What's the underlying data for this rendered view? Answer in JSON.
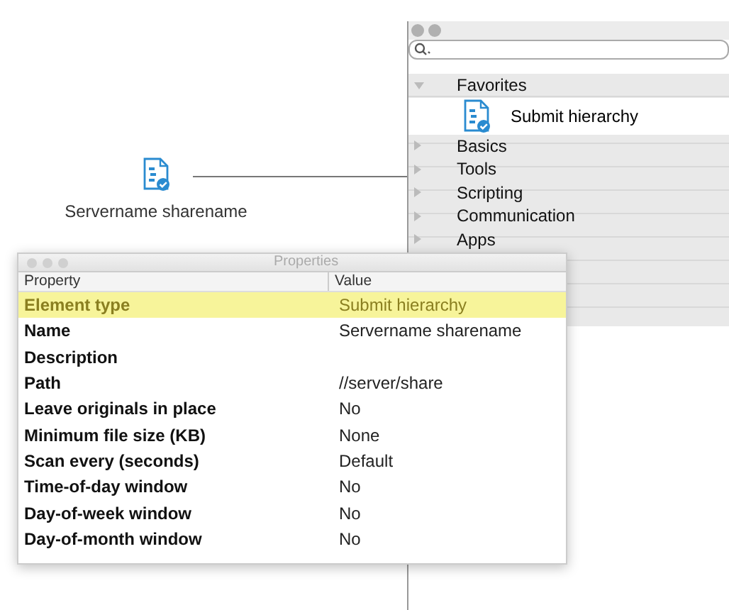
{
  "canvas": {
    "node": {
      "label": "Servername sharename"
    }
  },
  "library": {
    "categories": [
      {
        "label": "Favorites",
        "expanded": true,
        "children": [
          {
            "label": "Submit hierarchy"
          }
        ]
      },
      {
        "label": "Basics",
        "expanded": false
      },
      {
        "label": "Tools",
        "expanded": false
      },
      {
        "label": "Scripting",
        "expanded": false
      },
      {
        "label": "Communication",
        "expanded": false
      },
      {
        "label": "Apps",
        "expanded": false
      }
    ]
  },
  "properties": {
    "title": "Properties",
    "columns": [
      "Property",
      "Value"
    ],
    "rows": [
      {
        "property": "Element type",
        "value": "Submit hierarchy",
        "selected": true
      },
      {
        "property": "Name",
        "value": "Servername sharename",
        "selected": false
      },
      {
        "property": "Description",
        "selected": false
      },
      {
        "property": "Path",
        "value": "//server/share",
        "selected": false
      },
      {
        "property": "Leave originals in place",
        "value": "No",
        "selected": false
      },
      {
        "property": "Minimum file size (KB)",
        "value": "None",
        "selected": false
      },
      {
        "property": "Scan every (seconds)",
        "value": "Default",
        "selected": false
      },
      {
        "property": "Time-of-day window",
        "value": "No",
        "selected": false
      },
      {
        "property": "Day-of-week window",
        "value": "No",
        "selected": false
      },
      {
        "property": "Day-of-month window",
        "value": "No",
        "selected": false
      }
    ]
  }
}
